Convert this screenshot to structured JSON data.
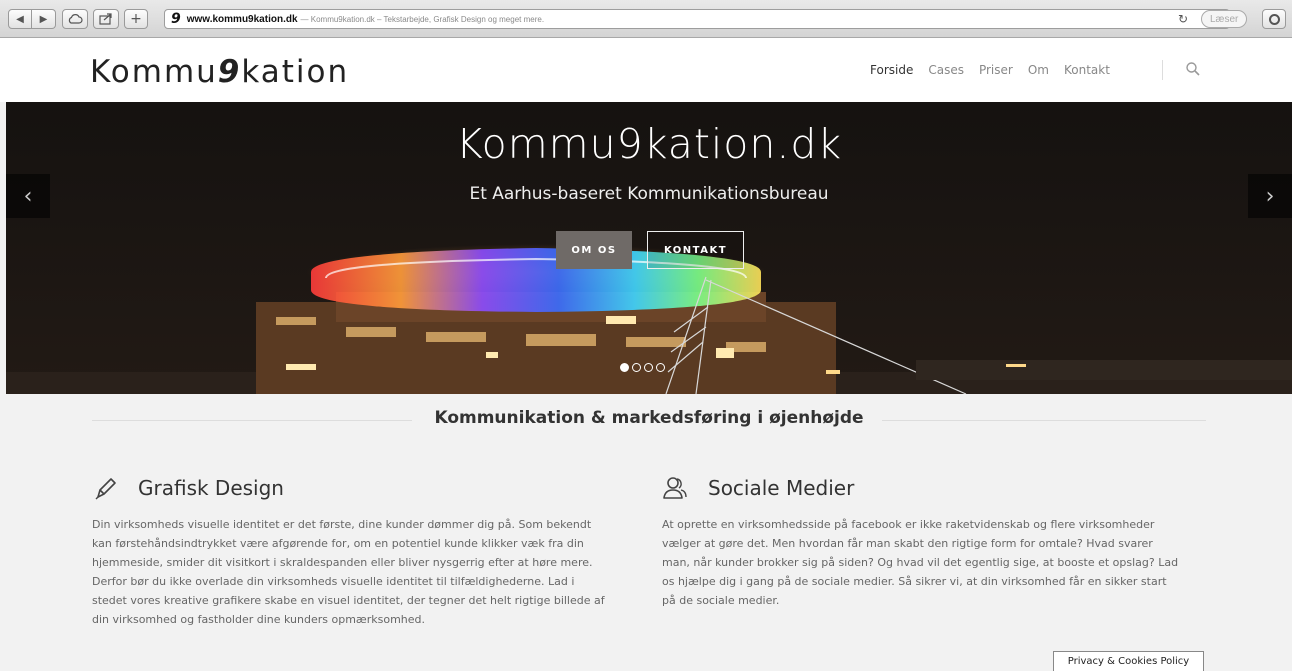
{
  "browser": {
    "favicon_char": "9",
    "url_domain": "www.kommu9kation.dk",
    "url_description": "— Kommu9kation.dk – Tekstarbejde, Grafisk Design og meget mere.",
    "reader_label": "Læser"
  },
  "header": {
    "logo_prefix": "Kommu",
    "logo_nine": "9",
    "logo_suffix": "kation",
    "nav": [
      "Forside",
      "Cases",
      "Priser",
      "Om",
      "Kontakt"
    ]
  },
  "hero": {
    "title": "Kommu9kation.dk",
    "subtitle": "Et Aarhus-baseret Kommunikationsbureau",
    "button_om": "OM OS",
    "button_kontakt": "KONTAKT",
    "slide_count": 4,
    "active_slide": 1
  },
  "section": {
    "heading": "Kommunikation & markedsføring i øjenhøjde"
  },
  "columns": [
    {
      "icon": "pencil-icon",
      "title": "Grafisk Design",
      "lines": [
        "Din virksomheds visuelle identitet er det første, dine kunder dømmer dig på. Som bekendt",
        "kan førstehåndsindtrykket være afgørende for, om en potentiel kunde klikker væk fra din",
        "hjemmeside, smider dit visitkort i skraldespanden eller bliver nysgerrig efter at høre mere.",
        "Derfor bør du ikke overlade din virksomheds visuelle identitet til tilfældighederne. Lad i",
        "stedet vores kreative grafikere skabe en visuel identitet, der tegner det helt rigtige billede af",
        "din virksomhed og fastholder dine kunders opmærksomhed."
      ]
    },
    {
      "icon": "users-icon",
      "title": "Sociale Medier",
      "lines": [
        "At oprette en virksomhedsside på facebook er ikke raketvidenskab og flere virksomheder",
        "vælger at gøre det. Men hvordan får man skabt den rigtige form for omtale? Hvad svarer",
        "man, når kunder brokker sig på siden? Og hvad vil det egentlig sige, at booste et opslag? Lad",
        "os hjælpe dig i gang på de sociale medier. Så sikrer vi, at din virksomhed får en sikker start",
        "på de sociale medier."
      ]
    }
  ],
  "footer": {
    "privacy_label": "Privacy & Cookies Policy"
  }
}
